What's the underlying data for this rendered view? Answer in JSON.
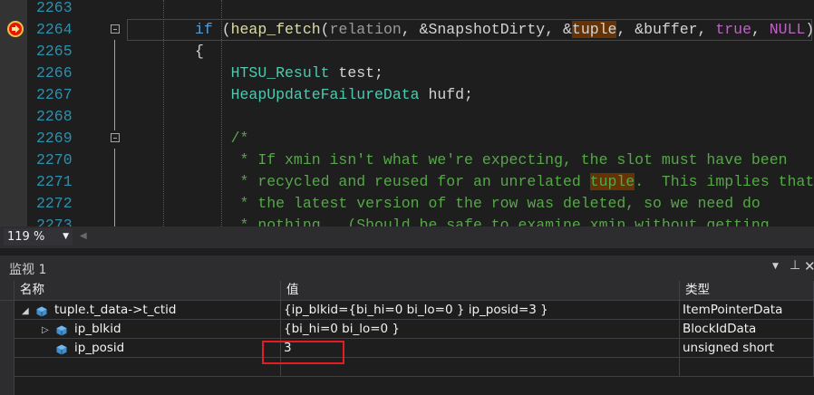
{
  "editor": {
    "lines": [
      {
        "number": "2263",
        "tokens": []
      },
      {
        "number": "2264",
        "tokens": [
          {
            "t": "if",
            "c": "kw"
          },
          {
            "t": " (",
            "c": ""
          },
          {
            "t": "heap_fetch",
            "c": "fn"
          },
          {
            "t": "(",
            "c": ""
          },
          {
            "t": "relation",
            "c": "pm"
          },
          {
            "t": ", &SnapshotDirty, &",
            "c": ""
          },
          {
            "t": "tuple",
            "c": "hl"
          },
          {
            "t": ", &buffer, ",
            "c": ""
          },
          {
            "t": "true",
            "c": "mac"
          },
          {
            "t": ", ",
            "c": ""
          },
          {
            "t": "NULL",
            "c": "mac"
          },
          {
            "t": "))",
            "c": ""
          }
        ]
      },
      {
        "number": "2265",
        "tokens": [
          {
            "t": "{",
            "c": ""
          }
        ]
      },
      {
        "number": "2266",
        "tokens": [
          {
            "t": "    ",
            "c": ""
          },
          {
            "t": "HTSU_Result",
            "c": "tp"
          },
          {
            "t": " test;",
            "c": ""
          }
        ]
      },
      {
        "number": "2267",
        "tokens": [
          {
            "t": "    ",
            "c": ""
          },
          {
            "t": "HeapUpdateFailureData",
            "c": "tp"
          },
          {
            "t": " hufd;",
            "c": ""
          }
        ]
      },
      {
        "number": "2268",
        "tokens": []
      },
      {
        "number": "2269",
        "tokens": [
          {
            "t": "    ",
            "c": ""
          },
          {
            "t": "/*",
            "c": "cm"
          }
        ]
      },
      {
        "number": "2270",
        "tokens": [
          {
            "t": "    ",
            "c": ""
          },
          {
            "t": " * If xmin isn't what we're expecting, the slot must have been",
            "c": "cm"
          }
        ]
      },
      {
        "number": "2271",
        "tokens": [
          {
            "t": "    ",
            "c": ""
          },
          {
            "t": " * recycled and reused for an unrelated ",
            "c": "cm"
          },
          {
            "t": "tuple",
            "c": "cm hl"
          },
          {
            "t": ".  This implies that",
            "c": "cm"
          }
        ]
      },
      {
        "number": "2272",
        "tokens": [
          {
            "t": "    ",
            "c": ""
          },
          {
            "t": " * the latest version of the row was deleted, so we need do",
            "c": "cm"
          }
        ]
      },
      {
        "number": "2273",
        "tokens": [
          {
            "t": "    ",
            "c": ""
          },
          {
            "t": " * nothing.  (Should be safe to examine xmin without getting",
            "c": "cm"
          }
        ]
      }
    ],
    "current_line_index": 1,
    "fold_markers": [
      1,
      6
    ],
    "breakpoint_icon": "breakpoint-current-statement-icon"
  },
  "zoom": {
    "value": "119 %"
  },
  "watch": {
    "title": "监视 1",
    "columns": {
      "name": "名称",
      "value": "值",
      "type": "类型"
    },
    "rows": [
      {
        "name": "tuple.t_data->t_ctid",
        "value": "{ip_blkid={bi_hi=0 bi_lo=0 } ip_posid=3 }",
        "type": "ItemPointerData",
        "expander": "expanded",
        "indent": 0
      },
      {
        "name": "ip_blkid",
        "value": "{bi_hi=0 bi_lo=0 }",
        "type": "BlockIdData",
        "expander": "collapsed",
        "indent": 1
      },
      {
        "name": "ip_posid",
        "value": "3",
        "type": "unsigned short",
        "expander": "none",
        "indent": 1
      },
      {
        "name": "",
        "value": "",
        "type": "",
        "expander": "none",
        "indent": 0
      }
    ],
    "icons": {
      "dropdown": "dropdown-arrow-icon",
      "pin": "pin-icon",
      "close": "close-icon"
    }
  },
  "colors": {
    "line_number": "#2b91af",
    "keyword": "#569cd6",
    "comment": "#57a64a",
    "highlight": "#653306",
    "annotation_box": "#e51c23"
  }
}
